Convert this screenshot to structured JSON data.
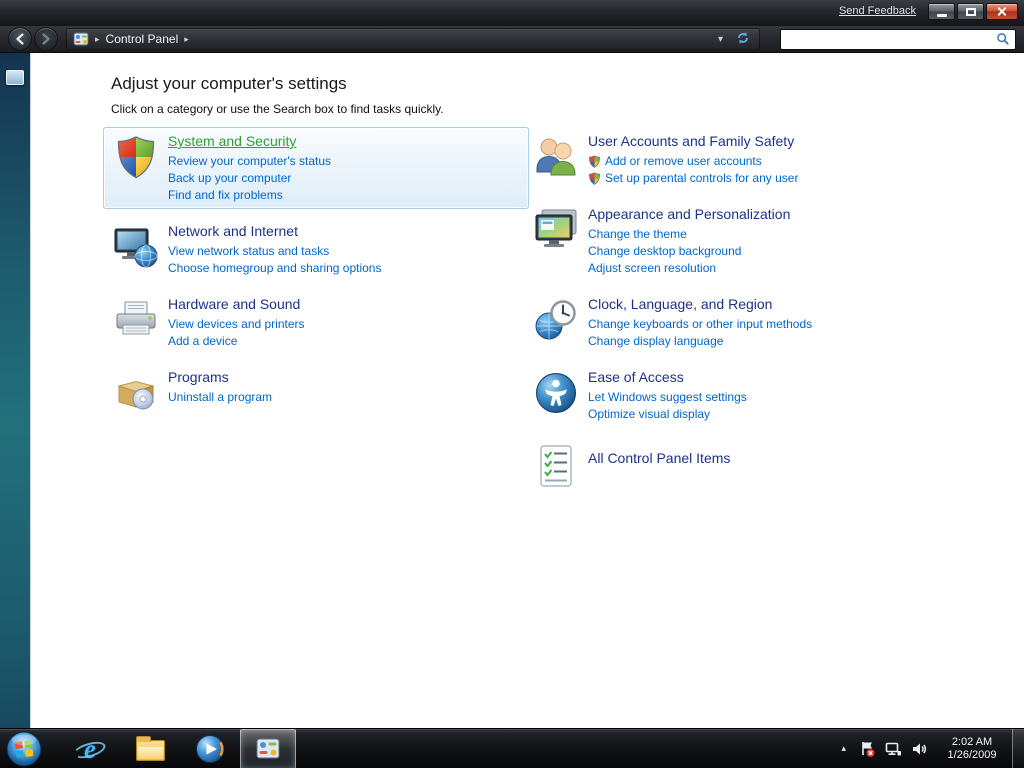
{
  "chrome": {
    "send_feedback": "Send Feedback"
  },
  "nav": {
    "breadcrumb": "Control Panel",
    "search_value": ""
  },
  "icons": {
    "breadcrumb_arrow": "▸",
    "dropdown_arrow": "▾",
    "tray_expand": "▴",
    "ie_glyph": "e"
  },
  "page": {
    "title": "Adjust your computer's settings",
    "subtitle": "Click on a category or use the Search box to find tasks quickly."
  },
  "left": {
    "system_security": {
      "title": "System and Security",
      "links": [
        "Review your computer's status",
        "Back up your computer",
        "Find and fix problems"
      ]
    },
    "network": {
      "title": "Network and Internet",
      "links": [
        "View network status and tasks",
        "Choose homegroup and sharing options"
      ]
    },
    "hardware": {
      "title": "Hardware and Sound",
      "links": [
        "View devices and printers",
        "Add a device"
      ]
    },
    "programs": {
      "title": "Programs",
      "links": [
        "Uninstall a program"
      ]
    }
  },
  "right": {
    "user_accounts": {
      "title": "User Accounts and Family Safety",
      "links": [
        "Add or remove user accounts",
        "Set up parental controls for any user"
      ]
    },
    "appearance": {
      "title": "Appearance and Personalization",
      "links": [
        "Change the theme",
        "Change desktop background",
        "Adjust screen resolution"
      ]
    },
    "clock_region": {
      "title": "Clock, Language, and Region",
      "links": [
        "Change keyboards or other input methods",
        "Change display language"
      ]
    },
    "ease": {
      "title": "Ease of Access",
      "links": [
        "Let Windows suggest settings",
        "Optimize visual display"
      ]
    },
    "all_items": {
      "title": "All Control Panel Items"
    }
  },
  "taskbar": {
    "time": "2:02 AM",
    "date": "1/26/2009"
  },
  "colors": {
    "category_title": "#1d3287",
    "task_link": "#0066cc",
    "hover_title_green": "#2f9e34",
    "close_button_red": "#c2512f",
    "highlight_border": "#a9cfe8"
  }
}
